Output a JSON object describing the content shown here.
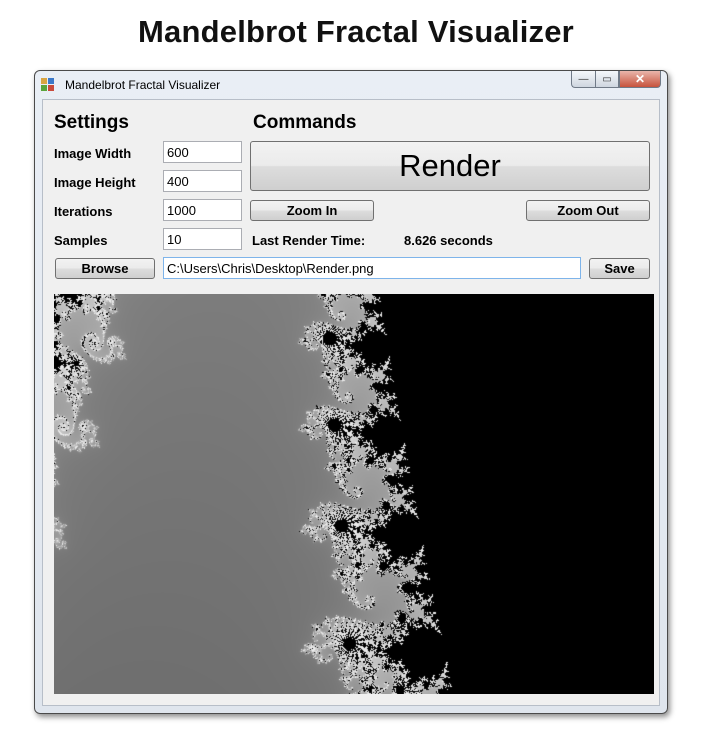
{
  "page": {
    "title": "Mandelbrot Fractal Visualizer"
  },
  "window": {
    "title": "Mandelbrot Fractal Visualizer",
    "caption": {
      "minimize": "—",
      "maximize": "▭",
      "close": "✕"
    }
  },
  "settings": {
    "heading": "Settings",
    "image_width_label": "Image Width",
    "image_width_value": "600",
    "image_height_label": "Image Height",
    "image_height_value": "400",
    "iterations_label": "Iterations",
    "iterations_value": "1000",
    "samples_label": "Samples",
    "samples_value": "10"
  },
  "commands": {
    "heading": "Commands",
    "render_label": "Render",
    "zoom_in_label": "Zoom In",
    "zoom_out_label": "Zoom Out",
    "last_render_label": "Last Render Time:",
    "last_render_value": "8.626 seconds"
  },
  "file": {
    "browse_label": "Browse",
    "path_value": "C:\\Users\\Chris\\Desktop\\Render.png",
    "save_label": "Save"
  },
  "icons": {
    "app": "app-window-icon",
    "minimize": "minimize-icon",
    "maximize": "maximize-icon",
    "close": "close-icon"
  },
  "colors": {
    "window_bg": "#f0f0f0",
    "fractal_dark": "#0b0b0b",
    "fractal_light": "#e6e6e6",
    "close_button": "#c7523c"
  }
}
